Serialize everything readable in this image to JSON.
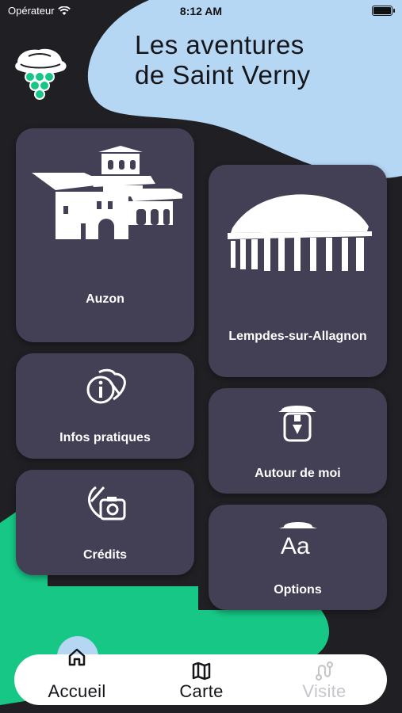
{
  "status_bar": {
    "carrier": "Opérateur",
    "time": "8:12 AM"
  },
  "header": {
    "title_line1": "Les aventures",
    "title_line2": "de Saint Verny"
  },
  "colors": {
    "card": "#433f55",
    "background": "#202024",
    "blue_blob": "#b5d7f3",
    "green_blob": "#16c785",
    "tab_active_bubble": "#b5d7f3"
  },
  "cards": {
    "auzon": {
      "label": "Auzon",
      "icon": "auzon-village-icon"
    },
    "lempdes": {
      "label": "Lempdes-sur-Allagnon",
      "icon": "rotunda-building-icon"
    },
    "infos": {
      "label": "Infos pratiques",
      "icon": "info-hat-icon"
    },
    "autour": {
      "label": "Autour de moi",
      "icon": "person-hat-icon"
    },
    "credits": {
      "label": "Crédits",
      "icon": "camera-hat-icon"
    },
    "options": {
      "label": "Options",
      "icon": "text-size-hat-icon"
    }
  },
  "tabs": [
    {
      "label": "Accueil",
      "icon": "home-icon",
      "state": "active"
    },
    {
      "label": "Carte",
      "icon": "map-icon",
      "state": "normal"
    },
    {
      "label": "Visite",
      "icon": "route-icon",
      "state": "disabled"
    }
  ]
}
